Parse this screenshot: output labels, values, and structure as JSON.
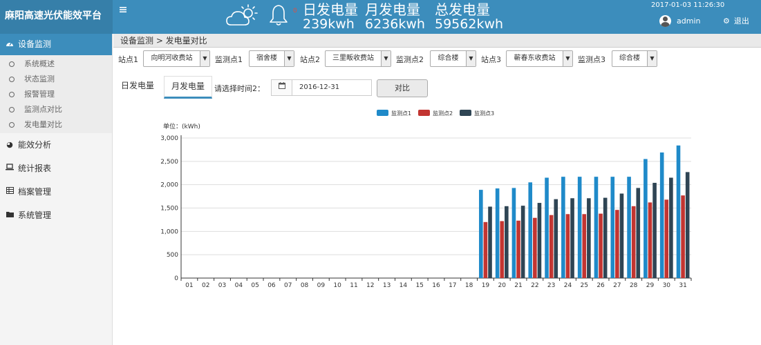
{
  "app": {
    "title": "麻阳高速光伏能效平台"
  },
  "header": {
    "menu_icon": "hamburger-icon",
    "weather_icon": "partly-sunny-icon",
    "bell_icon": "bell-icon",
    "bell_badge": "0",
    "stats": [
      {
        "label": "日发电量",
        "value": "239kwh"
      },
      {
        "label": "月发电量",
        "value": "6236kwh"
      },
      {
        "label": "总发电量",
        "value": "59562kwh"
      }
    ],
    "datetime": "2017-01-03 11:26:30",
    "user": "admin",
    "logout": "退出"
  },
  "sidebar": {
    "active_group": "设备监测",
    "sub_items": [
      "系统概述",
      "状态监测",
      "报警管理",
      "监测点对比",
      "发电量对比"
    ],
    "groups": [
      "能效分析",
      "统计报表",
      "档案管理",
      "系统管理"
    ]
  },
  "breadcrumb": "设备监测 > 发电量对比",
  "filters": {
    "station1_label": "站点1",
    "station1": "向明河收费站",
    "point1_label": "监测点1",
    "point1": "宿舍楼",
    "station2_label": "站点2",
    "station2": "三里畈收费站",
    "point2_label": "监测点2",
    "point2": "综合楼",
    "station3_label": "站点3",
    "station3": "蕲春东收费站",
    "point3_label": "监测点3",
    "point3": "综合楼"
  },
  "tabs": [
    "日发电量",
    "月发电量"
  ],
  "date_label": "请选择时间2：",
  "date_value": "2016-12-31",
  "compare_button": "对比",
  "colors": {
    "accent": "#3c8dbc",
    "series1": "#1f8ac9",
    "series2": "#c23531",
    "series3": "#2f4554"
  },
  "chart_data": {
    "type": "bar",
    "unit_label": "单位：(kWh)",
    "categories": [
      "01",
      "02",
      "03",
      "04",
      "05",
      "06",
      "07",
      "08",
      "09",
      "10",
      "11",
      "12",
      "13",
      "14",
      "15",
      "16",
      "17",
      "18",
      "19",
      "20",
      "21",
      "22",
      "23",
      "24",
      "25",
      "26",
      "27",
      "28",
      "29",
      "30",
      "31"
    ],
    "ylim": [
      0,
      3000
    ],
    "yticks": [
      "0",
      "500",
      "1,000",
      "1,500",
      "2,000",
      "2,500",
      "3,000"
    ],
    "legend_position": "top",
    "grid": true,
    "series": [
      {
        "name": "监测点1",
        "values": [
          0,
          0,
          0,
          0,
          0,
          0,
          0,
          0,
          0,
          0,
          0,
          0,
          0,
          0,
          0,
          0,
          0,
          0,
          1890,
          1920,
          1930,
          2050,
          2150,
          2170,
          2170,
          2170,
          2170,
          2170,
          2550,
          2690,
          2840
        ]
      },
      {
        "name": "监测点2",
        "values": [
          0,
          0,
          0,
          0,
          0,
          0,
          0,
          0,
          0,
          0,
          0,
          0,
          0,
          0,
          0,
          0,
          0,
          0,
          1200,
          1220,
          1230,
          1290,
          1350,
          1370,
          1370,
          1380,
          1460,
          1540,
          1620,
          1680,
          1770
        ]
      },
      {
        "name": "监测点3",
        "values": [
          0,
          0,
          0,
          0,
          0,
          0,
          0,
          0,
          0,
          0,
          0,
          0,
          0,
          0,
          0,
          0,
          0,
          0,
          1530,
          1540,
          1550,
          1610,
          1690,
          1710,
          1710,
          1720,
          1810,
          1930,
          2040,
          2150,
          2270
        ]
      }
    ]
  }
}
